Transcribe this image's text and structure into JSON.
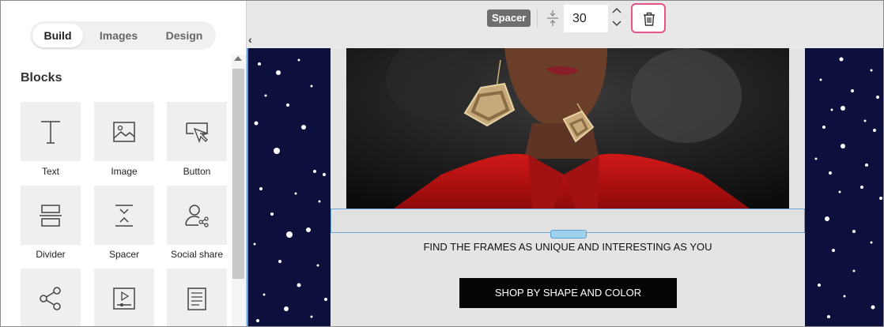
{
  "sidebar": {
    "tabs": [
      {
        "label": "Build",
        "active": true
      },
      {
        "label": "Images",
        "active": false
      },
      {
        "label": "Design",
        "active": false
      }
    ],
    "section_title": "Blocks",
    "blocks": [
      {
        "label": "Text",
        "icon": "text-icon"
      },
      {
        "label": "Image",
        "icon": "image-icon"
      },
      {
        "label": "Button",
        "icon": "button-icon"
      },
      {
        "label": "Divider",
        "icon": "divider-icon"
      },
      {
        "label": "Spacer",
        "icon": "spacer-icon"
      },
      {
        "label": "Social share",
        "icon": "social-share-icon"
      },
      {
        "label": "",
        "icon": "share-icon"
      },
      {
        "label": "",
        "icon": "video-icon"
      },
      {
        "label": "",
        "icon": "document-icon"
      }
    ]
  },
  "toolbar": {
    "block_type": "Spacer",
    "height_value": "30",
    "highlight_color": "#e6528a"
  },
  "email": {
    "headline": "FIND THE FRAMES AS UNIQUE AND INTERESTING AS YOU",
    "button_label": "SHOP BY SHAPE AND COLOR",
    "side_color": "#0d0f3d",
    "button_color": "#050505"
  },
  "colors": {
    "accent": "#e6528a",
    "selection": "#5aa0dc"
  }
}
